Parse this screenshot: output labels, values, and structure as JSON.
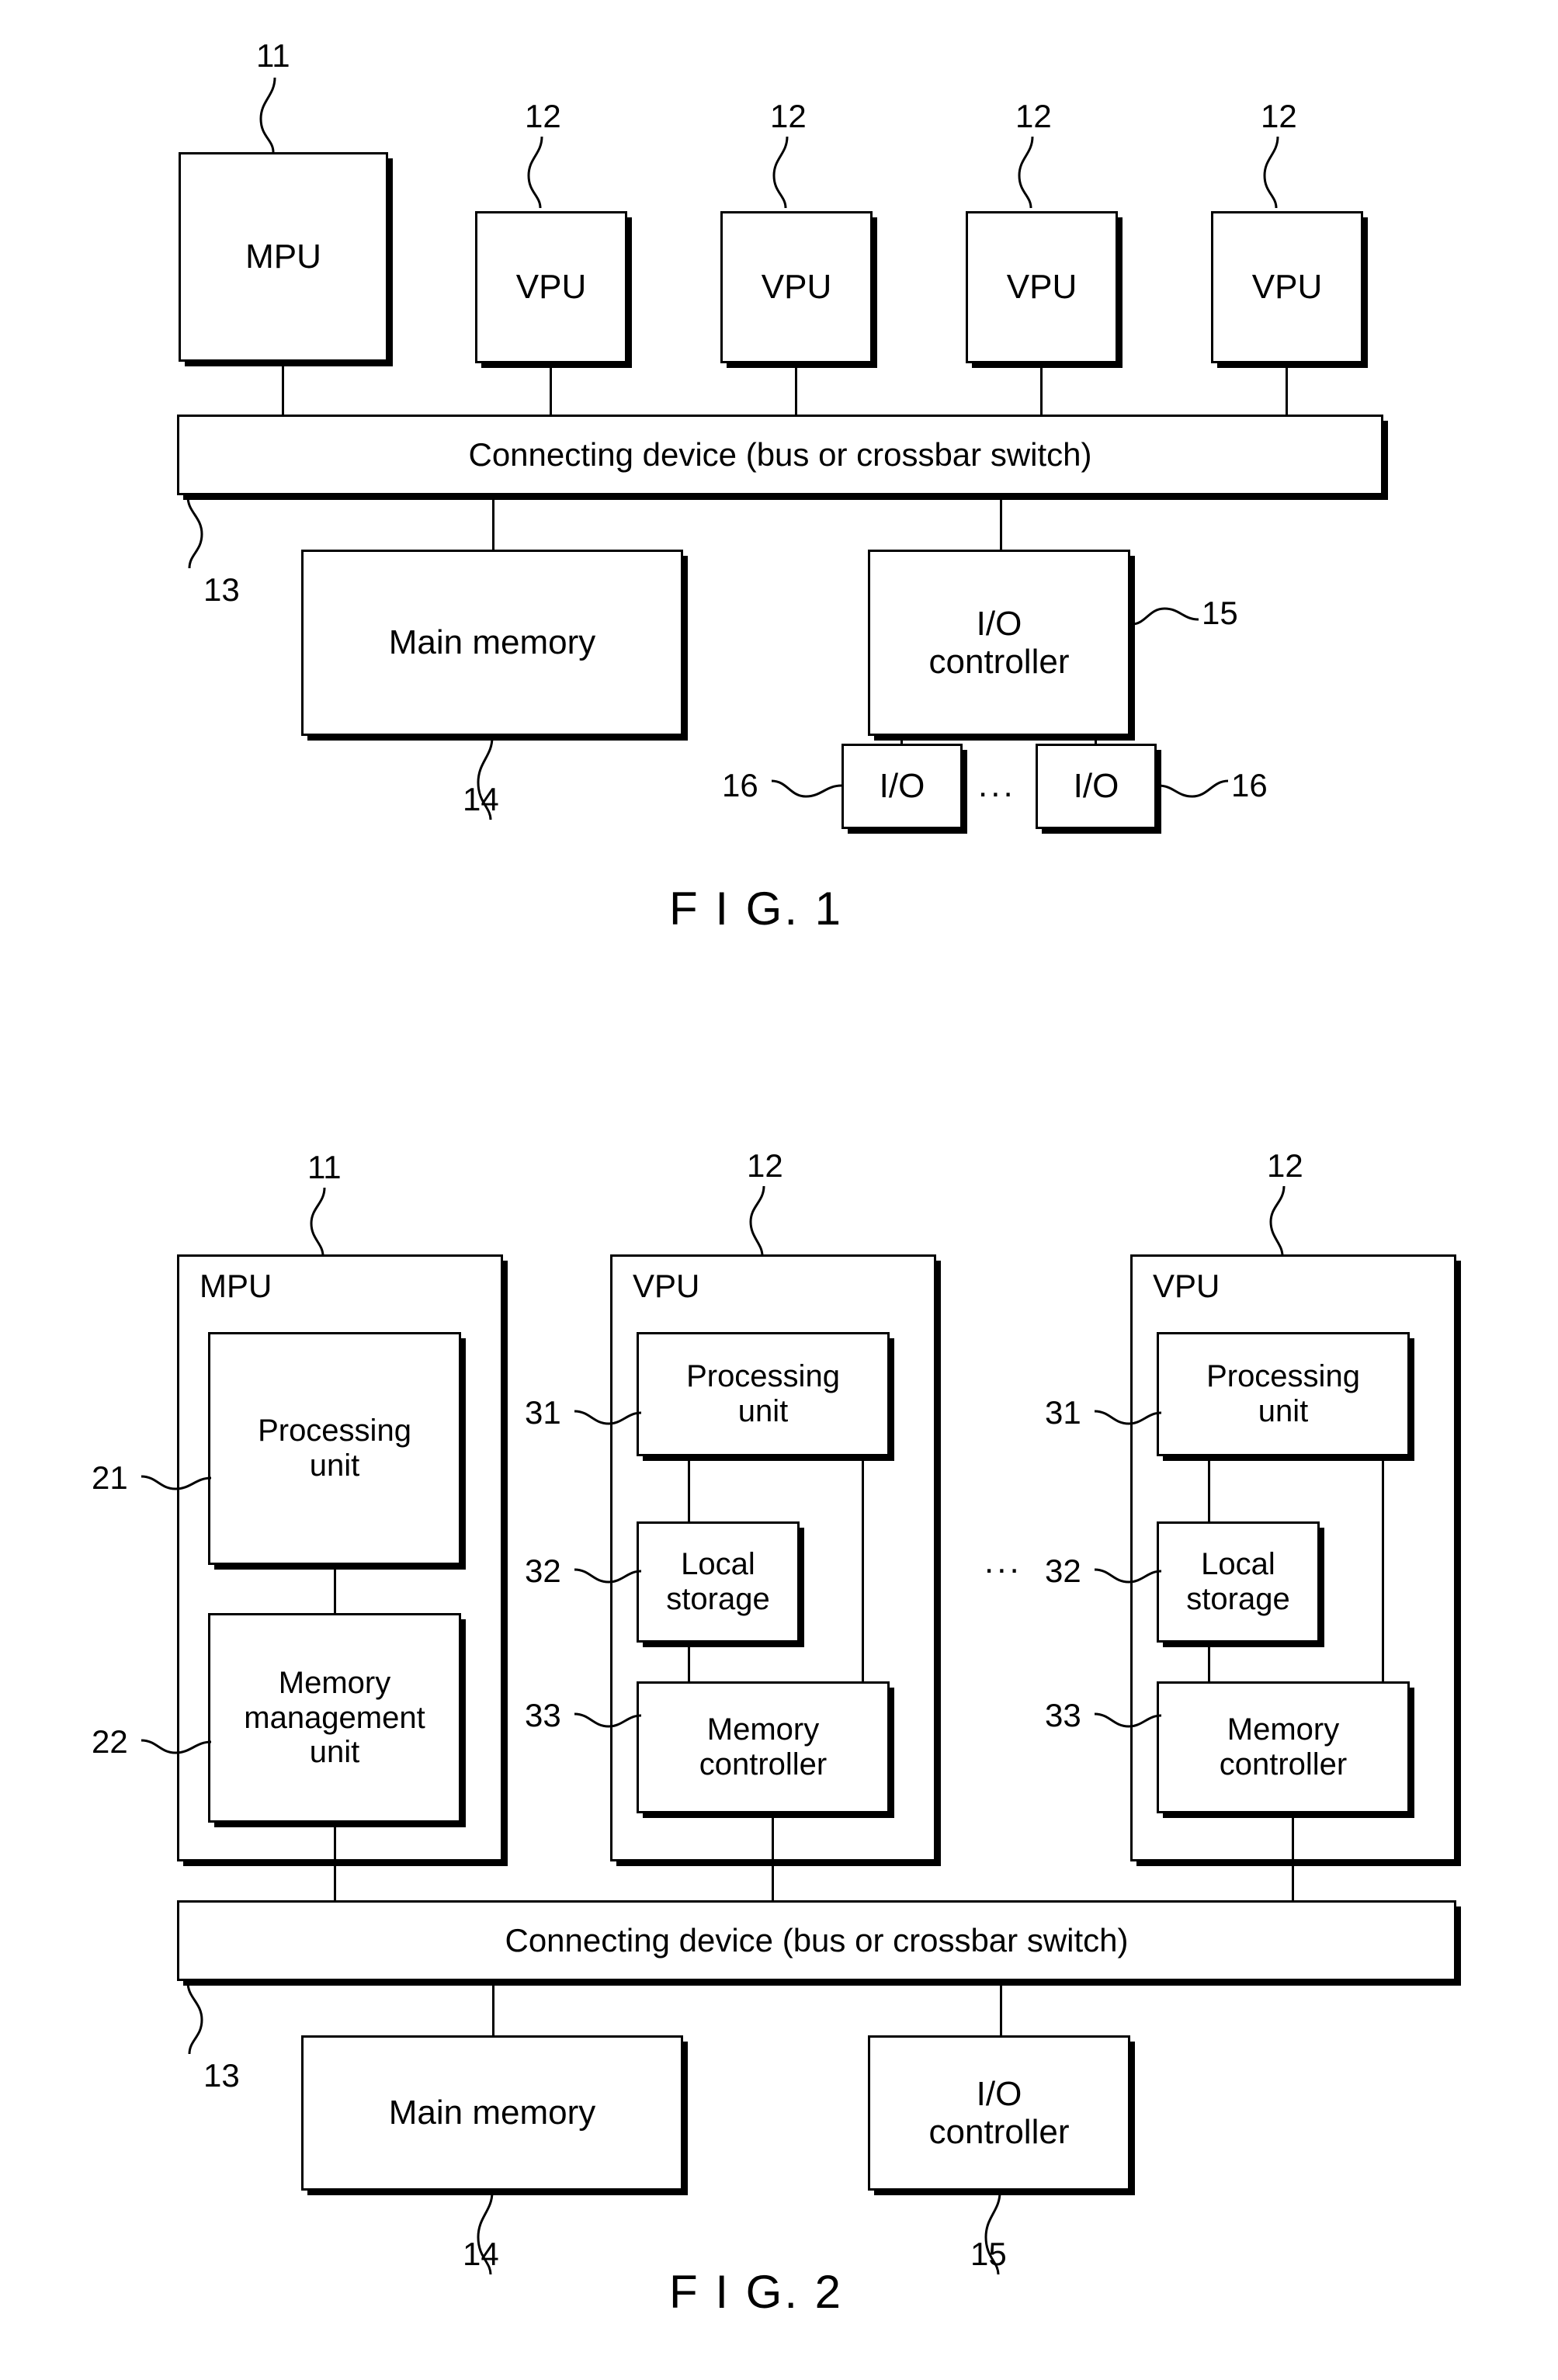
{
  "figure1": {
    "caption": "F I G. 1",
    "processors": [
      {
        "label": "MPU",
        "ref": "11"
      },
      {
        "label": "VPU",
        "ref": "12"
      },
      {
        "label": "VPU",
        "ref": "12"
      },
      {
        "label": "VPU",
        "ref": "12"
      },
      {
        "label": "VPU",
        "ref": "12"
      }
    ],
    "bus": {
      "label": "Connecting device (bus or crossbar switch)",
      "ref": "13"
    },
    "main_memory": {
      "label": "Main memory",
      "ref": "14"
    },
    "io_controller": {
      "label_line1": "I/O",
      "label_line2": "controller",
      "ref": "15"
    },
    "io_devices": [
      {
        "label": "I/O",
        "ref": "16"
      },
      {
        "label": "I/O",
        "ref": "16"
      }
    ],
    "ellipsis": "..."
  },
  "figure2": {
    "caption": "F I G. 2",
    "mpu": {
      "title": "MPU",
      "ref": "11",
      "blocks": [
        {
          "line1": "Processing",
          "line2": "unit",
          "ref": "21"
        },
        {
          "line1": "Memory",
          "line2": "management",
          "line3": "unit",
          "ref": "22"
        }
      ]
    },
    "vpus": [
      {
        "title": "VPU",
        "ref": "12",
        "blocks": [
          {
            "line1": "Processing",
            "line2": "unit",
            "ref": "31"
          },
          {
            "line1": "Local",
            "line2": "storage",
            "ref": "32"
          },
          {
            "line1": "Memory",
            "line2": "controller",
            "ref": "33"
          }
        ]
      },
      {
        "title": "VPU",
        "ref": "12",
        "blocks": [
          {
            "line1": "Processing",
            "line2": "unit",
            "ref": "31"
          },
          {
            "line1": "Local",
            "line2": "storage",
            "ref": "32"
          },
          {
            "line1": "Memory",
            "line2": "controller",
            "ref": "33"
          }
        ]
      }
    ],
    "ellipsis": "...",
    "bus": {
      "label": "Connecting device (bus or crossbar switch)",
      "ref": "13"
    },
    "main_memory": {
      "label": "Main memory",
      "ref": "14"
    },
    "io_controller": {
      "label_line1": "I/O",
      "label_line2": "controller",
      "ref": "15"
    }
  }
}
